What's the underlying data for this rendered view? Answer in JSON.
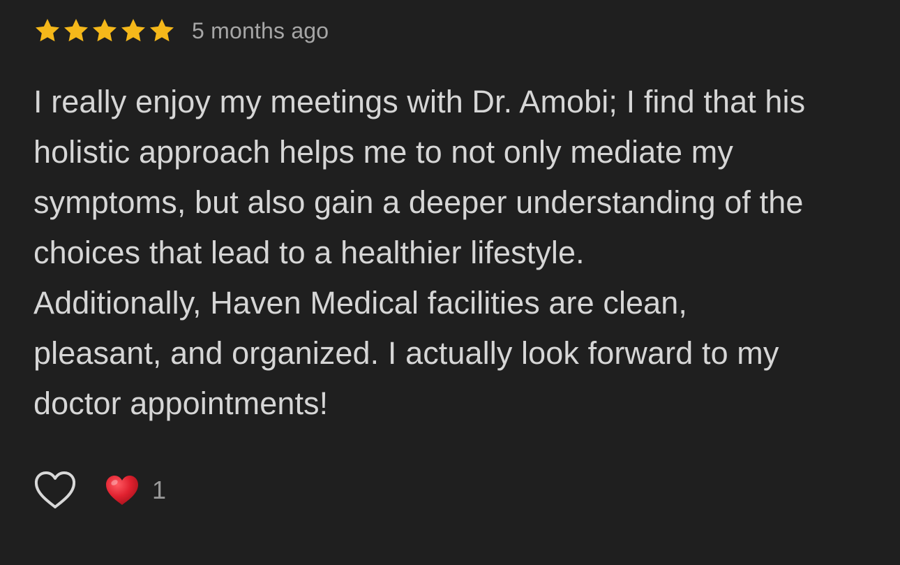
{
  "review": {
    "rating": 5,
    "rating_max": 5,
    "star_color": "#f5b81a",
    "time_ago": "5 months ago",
    "text_lines": [
      "I really enjoy my meetings with Dr. Amobi; I find that his",
      "holistic approach helps me to not only mediate my",
      "symptoms, but also gain a deeper understanding of the",
      "choices that lead to a healthier lifestyle.",
      "Additionally, Haven Medical facilities are clean,",
      "pleasant, and organized. I actually look forward to my",
      "doctor appointments!"
    ]
  },
  "actions": {
    "like_icon": "heart-outline-icon",
    "reaction_icon": "red-heart-icon",
    "reaction_color": "#e0212f",
    "reaction_count": "1"
  }
}
